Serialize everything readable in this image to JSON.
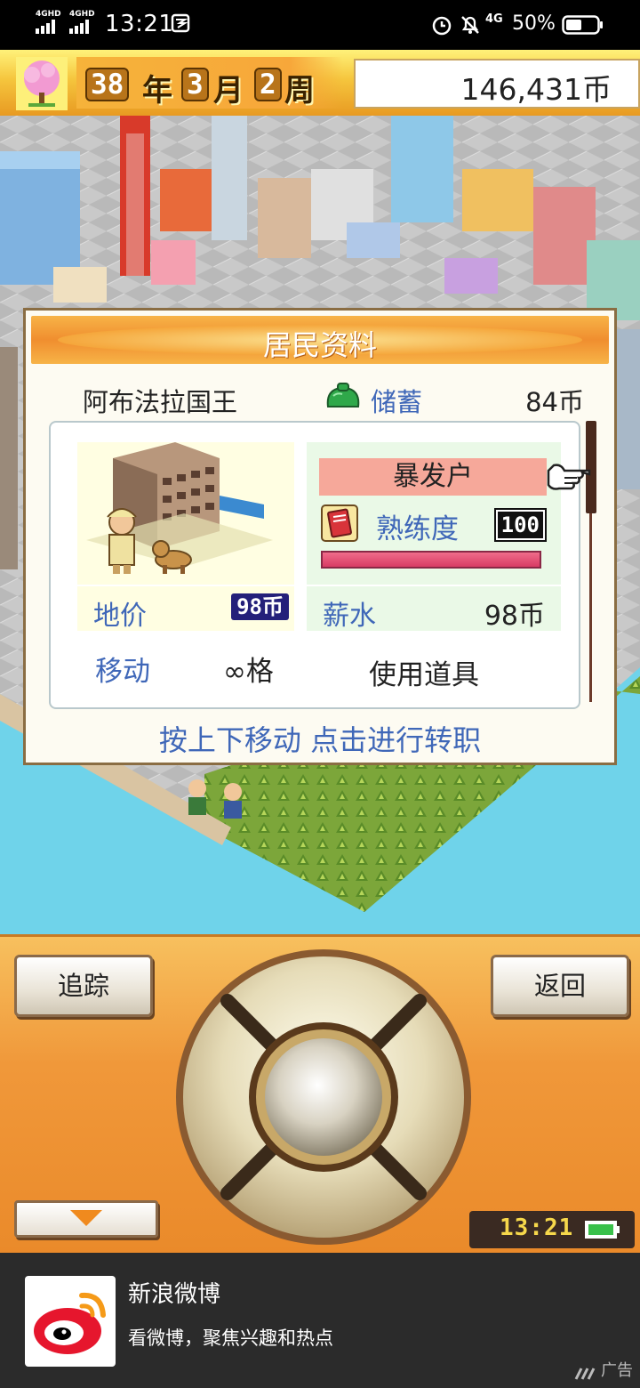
{
  "status_bar": {
    "net1": "4GHD",
    "net2": "4GHD",
    "time": "13:21",
    "data_type": "4G",
    "battery_percent": "50%",
    "battery_level": 0.5
  },
  "top_bar": {
    "year": "38",
    "year_unit": "年",
    "month": "3",
    "month_unit": "月",
    "week": "2",
    "week_unit": "周",
    "money": "146,431币"
  },
  "dialog": {
    "title": "居民资料",
    "resident_name": "阿布法拉国王",
    "savings_label": "储蓄",
    "savings_value": "84币",
    "land_price_label": "地价",
    "land_price_value": "98币",
    "job_title": "暴发户",
    "skill_label": "熟练度",
    "skill_value": "100",
    "skill_fill": 1.0,
    "salary_label": "薪水",
    "salary_value": "98币",
    "move_label": "移动",
    "move_value": "∞格",
    "use_item_label": "使用道具",
    "hint": "按上下移动 点击进行转职"
  },
  "controller": {
    "track_label": "追踪",
    "back_label": "返回",
    "clock": "13:21"
  },
  "ad": {
    "title": "新浪微博",
    "description": "看微博，聚焦兴趣和热点",
    "tag": "广告"
  },
  "colors": {
    "label_blue": "#3f67b8",
    "dialog_header": "#f08e2f",
    "controller_bg": "#f0983a",
    "ad_bg": "#2b2b2b"
  }
}
